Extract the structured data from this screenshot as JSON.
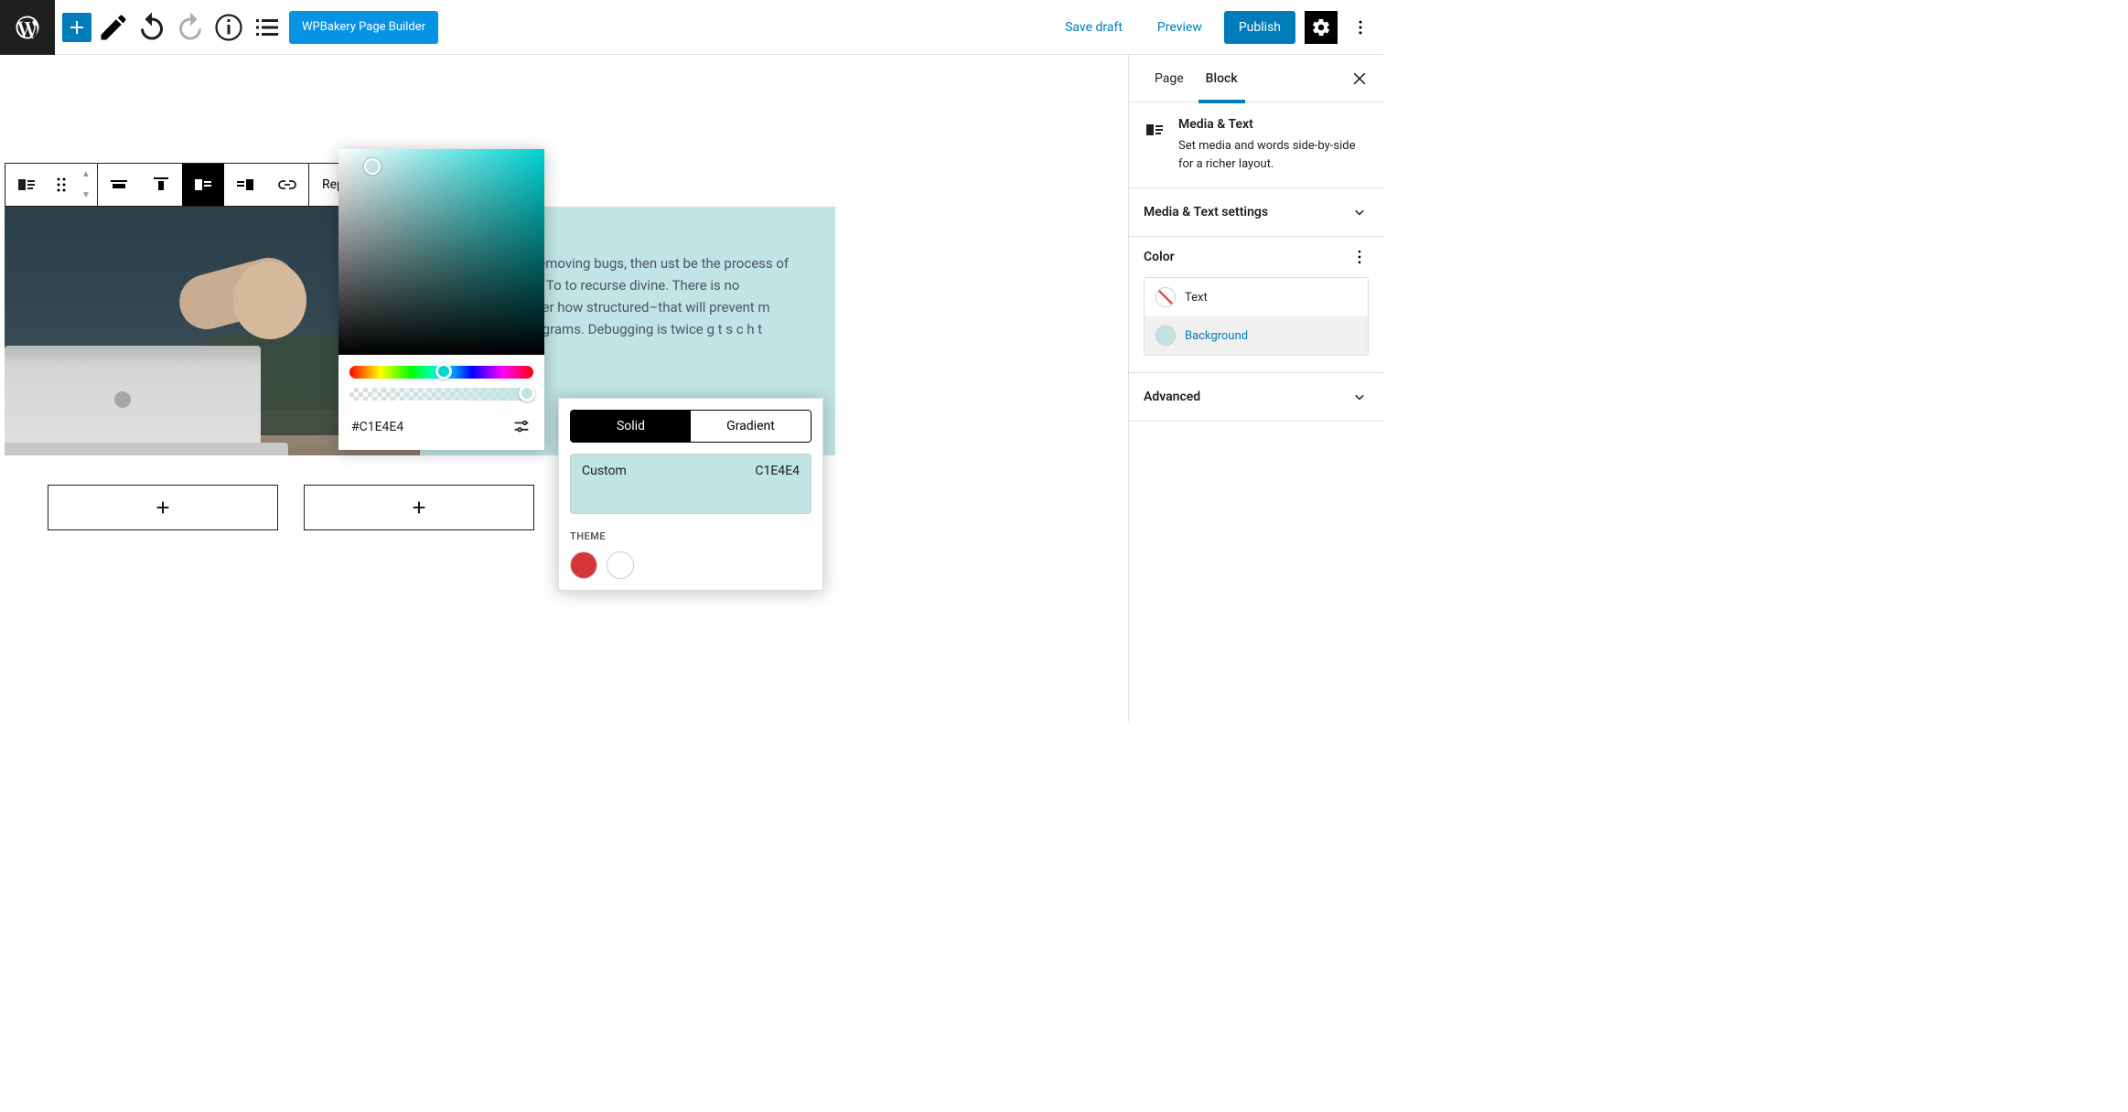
{
  "topbar": {
    "wpbakery_label": "WPBakery Page Builder",
    "save_draft": "Save draft",
    "preview": "Preview",
    "publish": "Publish"
  },
  "toolbar": {
    "replace_label": "Replace"
  },
  "block_content": {
    "text": "he process of removing bugs, then ust be the process of putting them in.  To to recurse divine. There is no programming tter how structured–that will prevent m making bad programs. Debugging is twice g t                                             s c                                                  h t"
  },
  "color_picker": {
    "hex": "#C1E4E4"
  },
  "palette": {
    "solid": "Solid",
    "gradient": "Gradient",
    "custom_label": "Custom",
    "custom_value": "C1E4E4",
    "theme_label": "THEME",
    "theme_colors": [
      "#d63638",
      "#ffffff"
    ]
  },
  "sidebar": {
    "tabs": {
      "page": "Page",
      "block": "Block"
    },
    "block_name": "Media & Text",
    "block_description": "Set media and words side-by-side for a richer layout.",
    "panels": {
      "settings": "Media & Text settings",
      "color": "Color",
      "advanced": "Advanced"
    },
    "color_rows": {
      "text": "Text",
      "background": "Background",
      "bg_color": "#c1e4e4"
    }
  }
}
